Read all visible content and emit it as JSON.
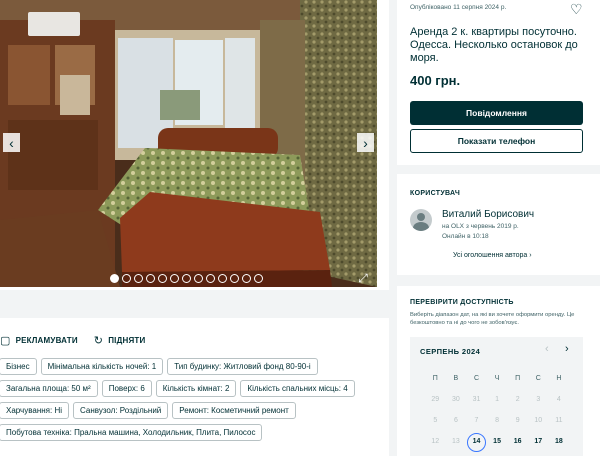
{
  "gallery": {
    "dots_count": 13,
    "active_dot": 0,
    "prev_label": "‹",
    "next_label": "›",
    "fullscreen_glyph": "⤢"
  },
  "actions": {
    "promote": "РЕКЛАМУВАТИ",
    "raise": "ПІДНЯТИ"
  },
  "tags": [
    "Бізнес",
    "Мінімальна кількість ночей: 1",
    "Тип будинку: Житловий фонд 80-90-і",
    "Загальна площа: 50 м²",
    "Поверх: 6",
    "Кількість кімнат: 2",
    "Кількість спальних місць: 4",
    "Харчування: Ні",
    "Санвузол: Роздільний",
    "Ремонт: Косметичний ремонт",
    "Побутова техніка: Пральна машина, Холодильник, Плита, Пилосос"
  ],
  "listing": {
    "published": "Опубліковано 11 серпня 2024 р.",
    "title": "Аренда 2 к. квартиры посуточно. Одесса. Несколько остановок до моря.",
    "price": "400 грн.",
    "message_btn": "Повідомлення",
    "phone_btn": "Показати телефон"
  },
  "user": {
    "section": "КОРИСТУВАЧ",
    "name": "Виталий Борисович",
    "since": "на OLX з червень 2019 р.",
    "online": "Онлайн в 10:18",
    "all_ads": "Усі оголошення автора"
  },
  "availability": {
    "section": "ПЕРЕВІРИТИ ДОСТУПНІСТЬ",
    "description": "Виберіть діапазон дат, на які ви хочете оформити оренду. Це безкоштовно та ні до чого не зобов'язує.",
    "month": "СЕРПЕНЬ 2024",
    "weekdays": [
      "П",
      "В",
      "С",
      "Ч",
      "П",
      "С",
      "Н"
    ],
    "rows": [
      [
        "29",
        "30",
        "31",
        "1",
        "2",
        "3",
        "4"
      ],
      [
        "5",
        "6",
        "7",
        "8",
        "9",
        "10",
        "11"
      ],
      [
        "12",
        "13",
        "14",
        "15",
        "16",
        "17",
        "18"
      ]
    ],
    "today": "14"
  },
  "colors": {
    "primary": "#002f34",
    "background": "#f2f4f5",
    "today_ring": "#3a77ff"
  },
  "icons": [
    "heart-icon",
    "chevron-left-icon",
    "chevron-right-icon",
    "fullscreen-icon",
    "promote-icon",
    "raise-icon",
    "avatar-icon"
  ]
}
